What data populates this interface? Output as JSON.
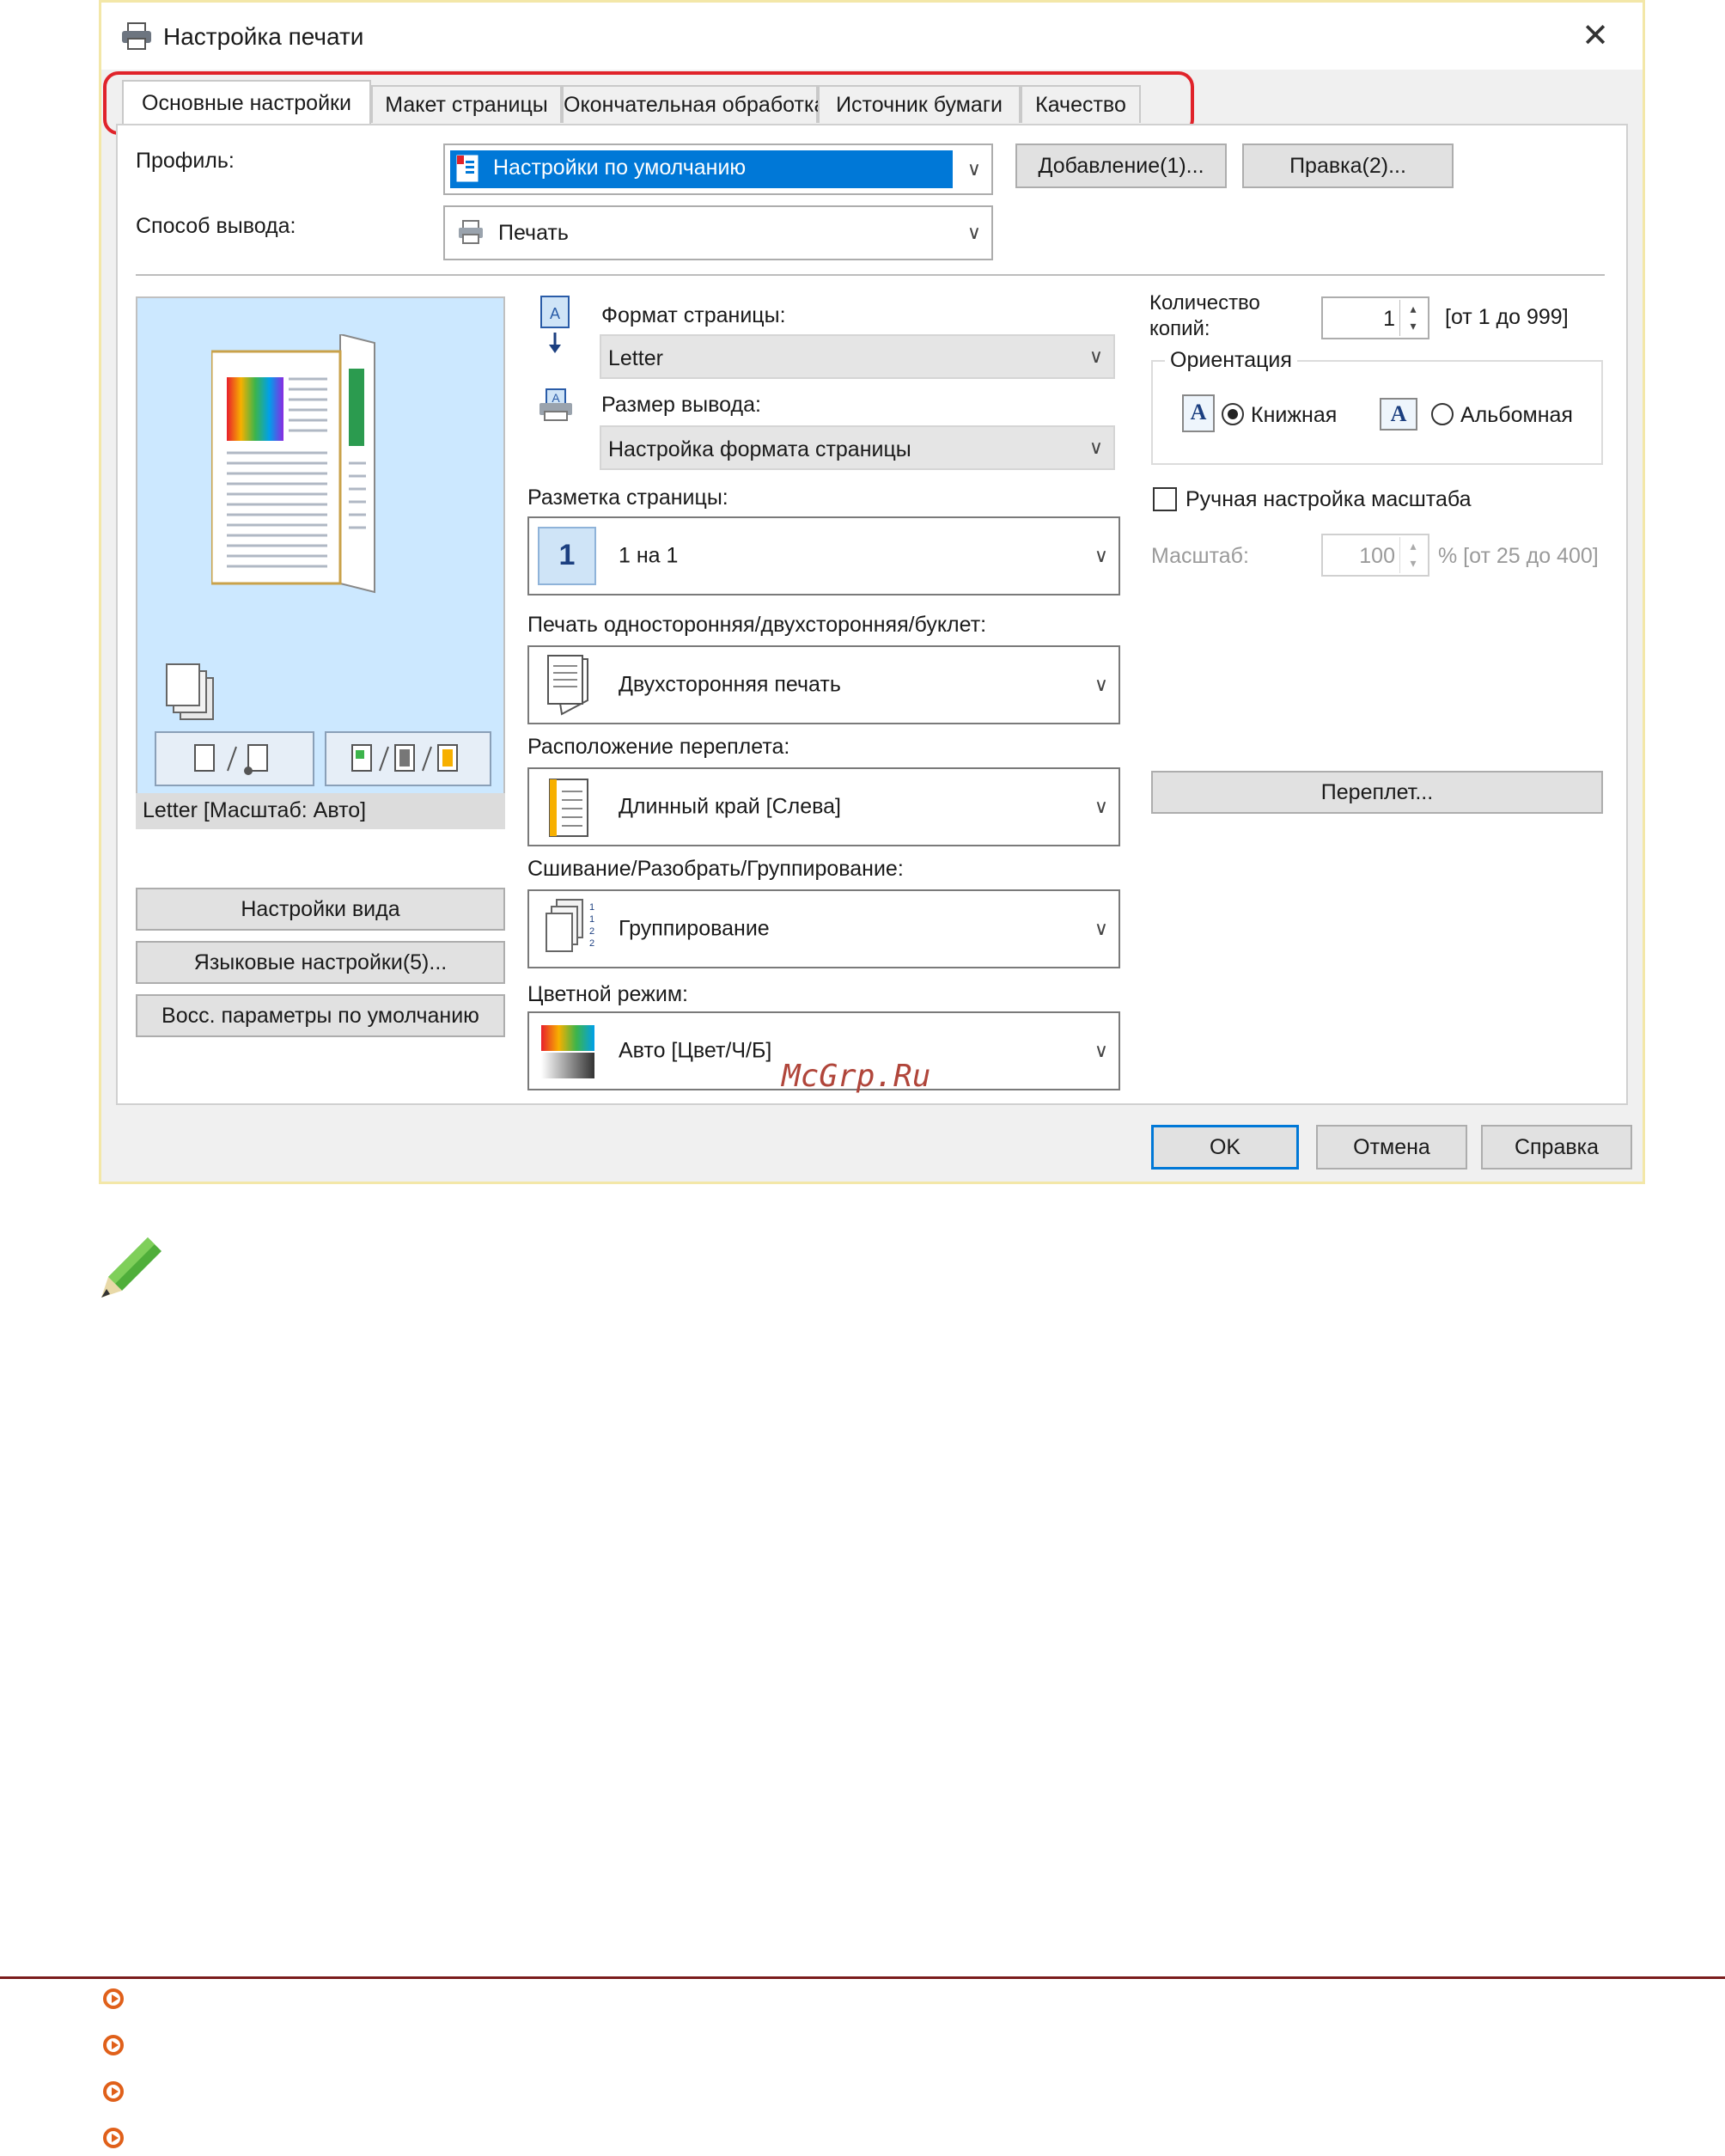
{
  "window": {
    "title": "Настройка печати",
    "tabs": [
      "Основные настройки",
      "Макет страницы",
      "Окончательная обработка",
      "Источник бумаги",
      "Качество"
    ]
  },
  "profile": {
    "label": "Профиль:",
    "value": "Настройки по умолчанию",
    "add_button": "Добавление(1)...",
    "edit_button": "Правка(2)..."
  },
  "output_method": {
    "label": "Способ вывода:",
    "value": "Печать"
  },
  "preview": {
    "caption": "Letter [Масштаб: Авто]"
  },
  "left_buttons": {
    "view": "Настройки вида",
    "language": "Языковые настройки(5)...",
    "restore": "Восс. параметры по умолчанию"
  },
  "page_size": {
    "label": "Формат страницы:",
    "value": "Letter"
  },
  "output_size": {
    "label": "Размер вывода:",
    "value": "Настройка формата страницы"
  },
  "layout": {
    "label": "Разметка страницы:",
    "icon_text": "1",
    "value": "1 на 1"
  },
  "duplex": {
    "label": "Печать односторонняя/двухсторонняя/буклет:",
    "value": "Двухсторонняя печать"
  },
  "binding": {
    "label": "Расположение переплета:",
    "value": "Длинный край [Слева]"
  },
  "collate": {
    "label": "Сшивание/Разобрать/Группирование:",
    "value": "Группирование"
  },
  "color_mode": {
    "label": "Цветной режим:",
    "value": "Авто [Цвет/Ч/Б]"
  },
  "copies": {
    "label_line1": "Количество",
    "label_line2": "копий:",
    "value": "1",
    "range": "[от 1 до 999]"
  },
  "orientation": {
    "group_label": "Ориентация",
    "portrait": "Книжная",
    "landscape": "Альбомная",
    "selected": "portrait",
    "icon_letter": "A"
  },
  "manual_scale": {
    "label": "Ручная настройка масштаба",
    "checked": false
  },
  "scale": {
    "label": "Масштаб:",
    "value": "100",
    "range": "% [от 25 до 400]"
  },
  "binding_button": "Переплет...",
  "footer_buttons": {
    "ok": "OK",
    "cancel": "Отмена",
    "help": "Справка"
  },
  "watermark": "McGrp.Ru",
  "colors": {
    "accent": "#0078d7",
    "highlight_border": "#e0232a",
    "window_border": "#f3e7a8",
    "bullet": "#e0601a",
    "footer_line": "#7a1c1c"
  }
}
